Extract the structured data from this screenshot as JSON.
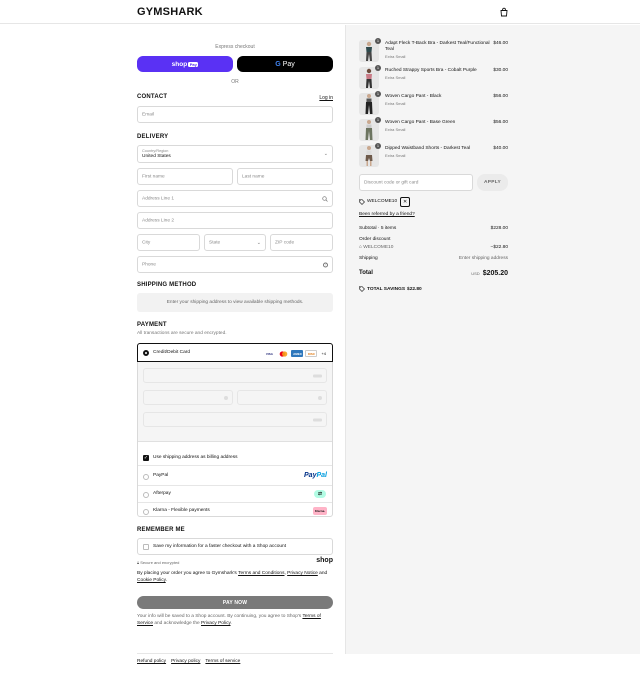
{
  "header": {
    "logo": "GYMSHARK",
    "bag_icon": "shopping-bag-icon"
  },
  "express": {
    "label": "Express checkout",
    "shoppay_text": "shop",
    "shoppay_badge": "Pay",
    "gpay_g": "G",
    "gpay_text": "Pay",
    "or": "OR"
  },
  "contact": {
    "title": "CONTACT",
    "login": "Log in",
    "email_placeholder": "Email"
  },
  "delivery": {
    "title": "DELIVERY",
    "country_label": "Country/Region",
    "country_value": "United States",
    "first_name": "First name",
    "last_name": "Last name",
    "address1": "Address Line 1",
    "address2": "Address Line 2",
    "city": "City",
    "state": "State",
    "zip": "ZIP code",
    "phone": "Phone"
  },
  "shipping": {
    "title": "SHIPPING METHOD",
    "message": "Enter your shipping address to view available shipping methods."
  },
  "payment": {
    "title": "PAYMENT",
    "subtitle": "All transactions are secure and encrypted.",
    "card_label": "Credit/Debit Card",
    "card_logos": [
      "VISA",
      "MC",
      "AMEX",
      "DISC"
    ],
    "more_cards": "+4",
    "billing_same": "Use shipping address as billing address",
    "paypal_label": "PayPal",
    "paypal_logo_a": "Pay",
    "paypal_logo_b": "Pal",
    "afterpay_label": "Afterpay",
    "klarna_label": "Klarna - Flexible payments",
    "klarna_logo": "Klarna."
  },
  "remember": {
    "title": "REMEMBER ME",
    "label": "Save my information for a faster checkout with a Shop account",
    "secure": "Secure and encrypted",
    "shop_logo": "shop"
  },
  "terms": {
    "prefix": "By placing your order you agree to Gymshark's ",
    "tc": "Terms and Conditions",
    "comma": ", ",
    "privacy": "Privacy Notice",
    "and": " and ",
    "cookie": "Cookie Policy",
    "end": "."
  },
  "pay_now": "PAY NOW",
  "shop_info": {
    "prefix": "Your info will be saved to a Shop account. By continuing, you agree to Shop's ",
    "tos": "Terms of Service",
    "mid": " and acknowledge the ",
    "privacy": "Privacy Policy",
    "end": "."
  },
  "footer": {
    "links": [
      "Refund policy",
      "Privacy policy",
      "Terms of service"
    ]
  },
  "cart": {
    "items": [
      {
        "qty": "1",
        "name": "Adapt Fleck T-Back Bra - Darkest Teal/Functional Teal",
        "variant": "Extra Small",
        "price": "$46.00",
        "color": "#2f4a4d"
      },
      {
        "qty": "1",
        "name": "Ruched Strappy Sports Bra - Cobalt Purple",
        "variant": "Extra Small",
        "price": "$30.00",
        "color": "#c97a86"
      },
      {
        "qty": "1",
        "name": "Woven Cargo Pant - Black",
        "variant": "Extra Small",
        "price": "$56.00",
        "color": "#222222"
      },
      {
        "qty": "1",
        "name": "Woven Cargo Pant - Base Green",
        "variant": "Extra Small",
        "price": "$56.00",
        "color": "#6c7460"
      },
      {
        "qty": "1",
        "name": "Dipped Waistband Shorts - Darkest Teal",
        "variant": "Extra Small",
        "price": "$40.00",
        "color": "#6e5a4b"
      }
    ],
    "discount_placeholder": "Discount code or gift card",
    "apply": "APPLY",
    "applied_code": "WELCOME10",
    "remove_icon": "✕",
    "referred": "Been referred by a friend?"
  },
  "summary": {
    "subtotal_label": "Subtotal · 5 items",
    "subtotal_value": "$228.00",
    "order_discount_label": "Order discount",
    "discount_code": "WELCOME10",
    "discount_value": "−$22.80",
    "shipping_label": "Shipping",
    "shipping_value": "Enter shipping address",
    "total_label": "Total",
    "currency": "USD",
    "total_value": "$205.20",
    "savings_label": "TOTAL SAVINGS",
    "savings_value": "$22.80"
  }
}
